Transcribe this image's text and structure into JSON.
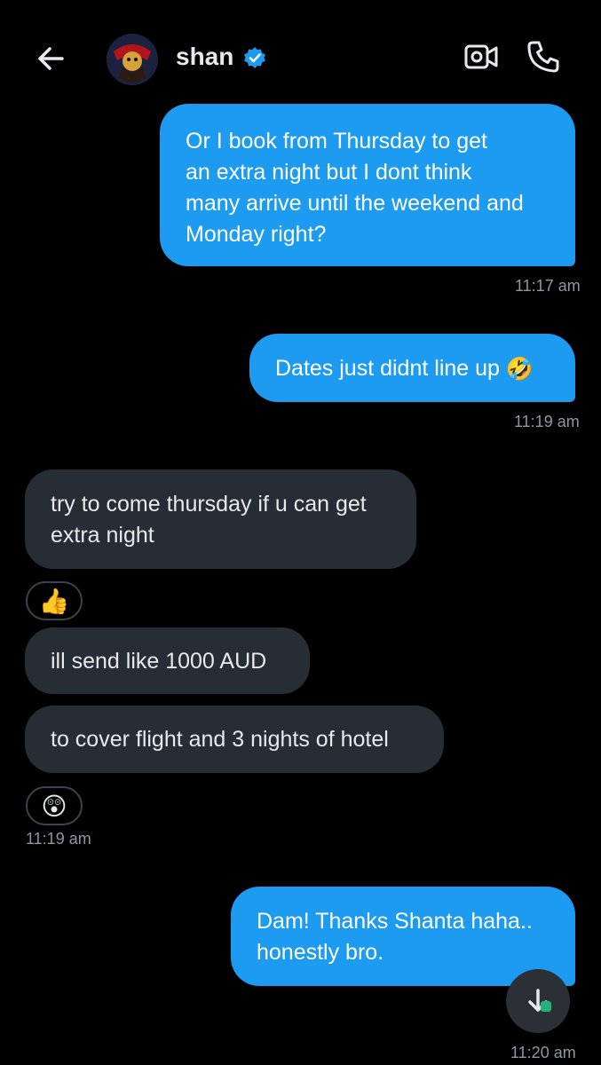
{
  "header": {
    "contact_name": "shan"
  },
  "messages": [
    {
      "text_lines": [
        "Or I book from Thursday to get",
        "an extra night but I dont think",
        "many arrive until the weekend and",
        "Monday right?"
      ],
      "time": "11:17 am"
    },
    {
      "text": "Dates just didnt line up",
      "emoji": "🤣",
      "time": "11:19 am"
    },
    {
      "text_lines": [
        "try to come thursday if u can get",
        "extra night"
      ],
      "reaction": "👍"
    },
    {
      "text": "ill send like 1000 AUD"
    },
    {
      "text": "to cover flight and 3 nights of hotel",
      "reaction": "😲",
      "time": "11:19 am"
    },
    {
      "text_lines": [
        "Dam! Thanks Shanta haha..",
        "honestly bro."
      ],
      "time": "11:20 am"
    }
  ],
  "colors": {
    "outgoing_bubble": "#1d9bf0",
    "incoming_bubble": "#262d34",
    "background": "#000000",
    "timestamp": "#8b98a5"
  }
}
